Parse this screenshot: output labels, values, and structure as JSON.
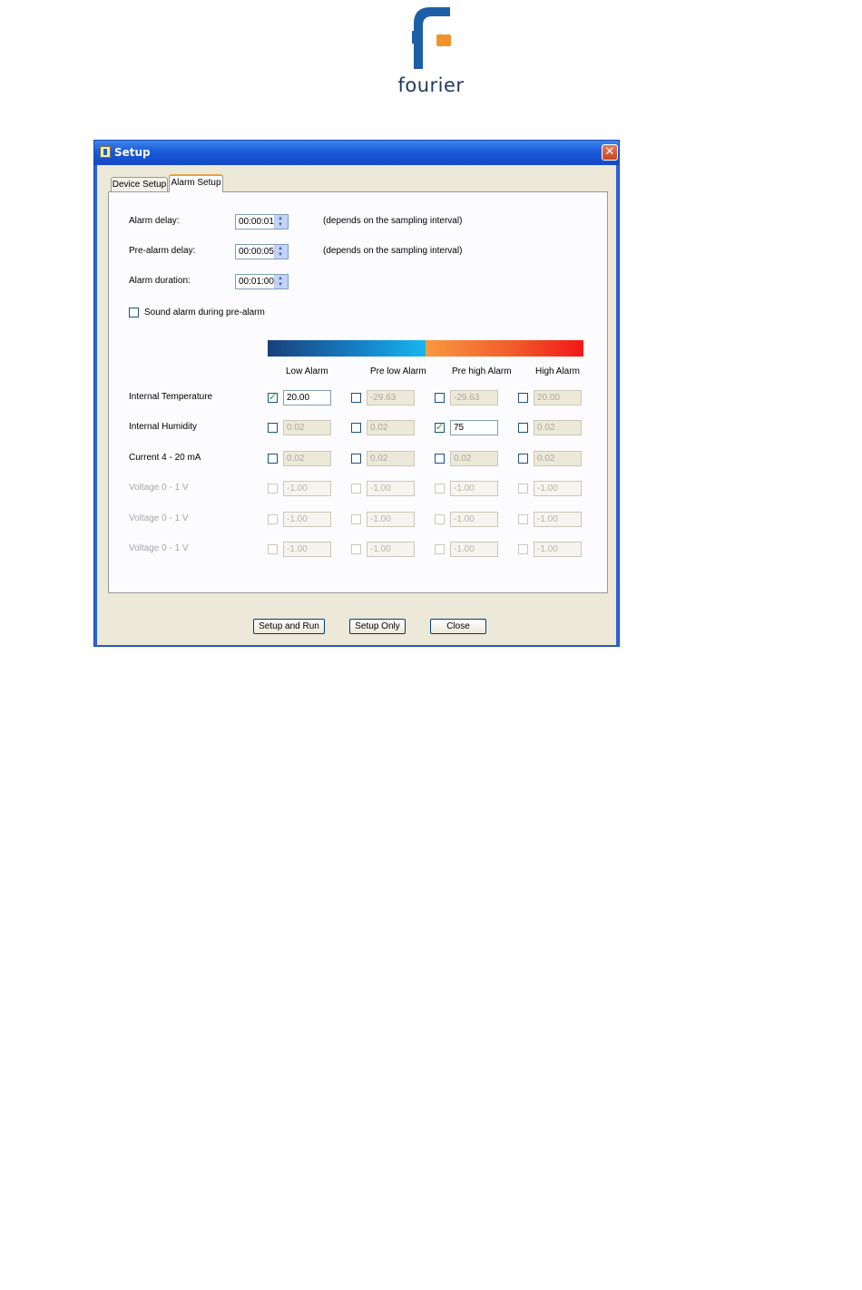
{
  "logo": {
    "text": "fourier",
    "colors": {
      "blue": "#1c5fa8",
      "orange": "#f0932b"
    }
  },
  "window": {
    "title": "Setup",
    "close_symbol": "✕",
    "colors": {
      "titlebar": "#1a5ad8",
      "client": "#ece9d8"
    }
  },
  "tabs": [
    {
      "label": "Device Setup",
      "active": false
    },
    {
      "label": "Alarm Setup",
      "active": true
    }
  ],
  "settings": {
    "alarm_delay": {
      "label": "Alarm delay:",
      "value": "00:00:01",
      "note": "(depends on the sampling interval)"
    },
    "pre_alarm_delay": {
      "label": "Pre-alarm delay:",
      "value": "00:00:05",
      "note": "(depends on the sampling interval)"
    },
    "alarm_duration": {
      "label": "Alarm duration:",
      "value": "00:01:00"
    },
    "sound_alarm": {
      "label": "Sound alarm during pre-alarm",
      "checked": false
    }
  },
  "columns": [
    "Low Alarm",
    "Pre low Alarm",
    "Pre high Alarm",
    "High Alarm"
  ],
  "rows": [
    {
      "label": "Internal Temperature",
      "enabled": true,
      "cells": [
        {
          "checked": true,
          "value": "20.00"
        },
        {
          "checked": false,
          "value": "-29.63"
        },
        {
          "checked": false,
          "value": "-29.63"
        },
        {
          "checked": false,
          "value": "20.00"
        }
      ]
    },
    {
      "label": "Internal Humidity",
      "enabled": true,
      "cells": [
        {
          "checked": false,
          "value": "0.02"
        },
        {
          "checked": false,
          "value": "0.02"
        },
        {
          "checked": true,
          "value": "75"
        },
        {
          "checked": false,
          "value": "0.02"
        }
      ]
    },
    {
      "label": "Current 4 - 20 mA",
      "enabled": true,
      "cells": [
        {
          "checked": false,
          "value": "0.02"
        },
        {
          "checked": false,
          "value": "0.02"
        },
        {
          "checked": false,
          "value": "0.02"
        },
        {
          "checked": false,
          "value": "0.02"
        }
      ]
    },
    {
      "label": "Voltage 0 - 1 V",
      "enabled": false,
      "cells": [
        {
          "checked": false,
          "value": "-1.00"
        },
        {
          "checked": false,
          "value": "-1.00"
        },
        {
          "checked": false,
          "value": "-1.00"
        },
        {
          "checked": false,
          "value": "-1.00"
        }
      ]
    },
    {
      "label": "Voltage 0 - 1 V",
      "enabled": false,
      "cells": [
        {
          "checked": false,
          "value": "-1.00"
        },
        {
          "checked": false,
          "value": "-1.00"
        },
        {
          "checked": false,
          "value": "-1.00"
        },
        {
          "checked": false,
          "value": "-1.00"
        }
      ]
    },
    {
      "label": "Voltage 0 - 1 V",
      "enabled": false,
      "cells": [
        {
          "checked": false,
          "value": "-1.00"
        },
        {
          "checked": false,
          "value": "-1.00"
        },
        {
          "checked": false,
          "value": "-1.00"
        },
        {
          "checked": false,
          "value": "-1.00"
        }
      ]
    }
  ],
  "buttons": {
    "setup_and_run": "Setup and Run",
    "setup_only": "Setup Only",
    "close": "Close"
  }
}
